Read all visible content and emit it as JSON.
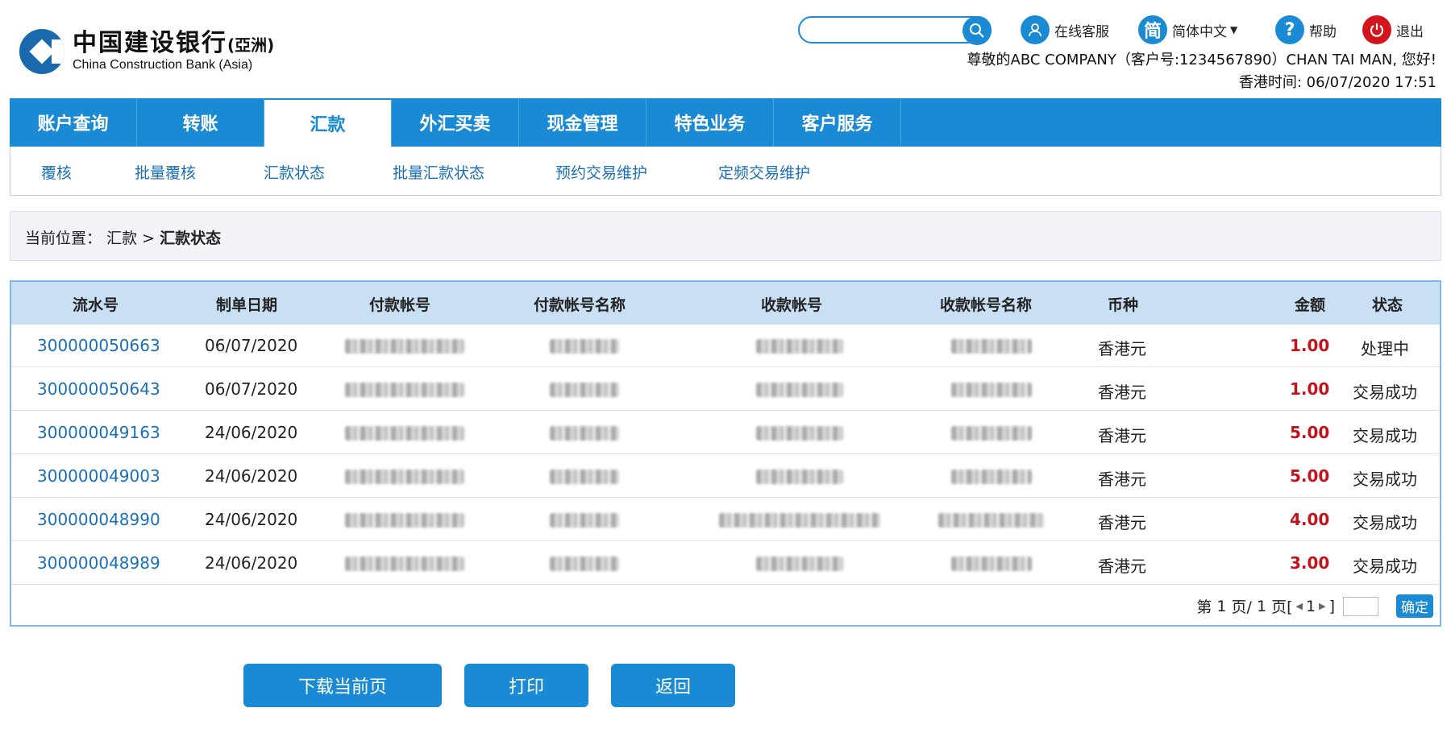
{
  "brand": {
    "name_cn": "中国建设银行",
    "name_cn_suffix": "(亞洲)",
    "name_en": "China Construction Bank (Asia)",
    "brand_color": "#1a69ad"
  },
  "header": {
    "search_placeholder": "",
    "tools": {
      "online_service": "在线客服",
      "language_icon_text": "简",
      "language": "简体中文",
      "help_icon_text": "?",
      "help": "帮助",
      "logout": "退出"
    },
    "greeting": "尊敬的ABC COMPANY（客户号:1234567890）CHAN TAI MAN, 您好!",
    "time_label": "香港时间:",
    "time_value": "06/07/2020 17:51"
  },
  "nav": {
    "tabs": [
      {
        "label": "账户查询"
      },
      {
        "label": "转账"
      },
      {
        "label": "汇款"
      },
      {
        "label": "外汇买卖"
      },
      {
        "label": "现金管理"
      },
      {
        "label": "特色业务"
      },
      {
        "label": "客户服务"
      }
    ],
    "active_tab": "汇款",
    "subnav": [
      {
        "label": "覆核"
      },
      {
        "label": "批量覆核"
      },
      {
        "label": "汇款状态"
      },
      {
        "label": "批量汇款状态"
      },
      {
        "label": "预约交易维护"
      },
      {
        "label": "定频交易维护"
      }
    ]
  },
  "breadcrumb": {
    "prefix": "当前位置：",
    "parent": "汇款",
    "separator": ">",
    "current": "汇款状态"
  },
  "table": {
    "headers": {
      "serial": "流水号",
      "date": "制单日期",
      "payer_account": "付款帐号",
      "payer_name": "付款帐号名称",
      "payee_account": "收款帐号",
      "payee_name": "收款帐号名称",
      "currency": "币种",
      "amount": "金额",
      "status": "状态"
    },
    "rows": [
      {
        "serial": "300000050663",
        "date": "06/07/2020",
        "currency": "香港元",
        "amount": "1.00",
        "status": "处理中"
      },
      {
        "serial": "300000050643",
        "date": "06/07/2020",
        "currency": "香港元",
        "amount": "1.00",
        "status": "交易成功"
      },
      {
        "serial": "300000049163",
        "date": "24/06/2020",
        "currency": "香港元",
        "amount": "5.00",
        "status": "交易成功"
      },
      {
        "serial": "300000049003",
        "date": "24/06/2020",
        "currency": "香港元",
        "amount": "5.00",
        "status": "交易成功"
      },
      {
        "serial": "300000048990",
        "date": "24/06/2020",
        "currency": "香港元",
        "amount": "4.00",
        "status": "交易成功"
      },
      {
        "serial": "300000048989",
        "date": "24/06/2020",
        "currency": "香港元",
        "amount": "3.00",
        "status": "交易成功"
      }
    ],
    "pager": {
      "page_prefix": "第",
      "current_page": "1",
      "page_mid": "页/",
      "total_pages": "1",
      "page_suffix": "页[",
      "page_number": "1",
      "close_bracket": "]",
      "confirm": "确定"
    }
  },
  "actions": {
    "download": "下载当前页",
    "print": "打印",
    "back": "返回"
  },
  "colors": {
    "primary": "#1a8ad4",
    "amount": "#c0141c",
    "link": "#1a6fb8"
  }
}
